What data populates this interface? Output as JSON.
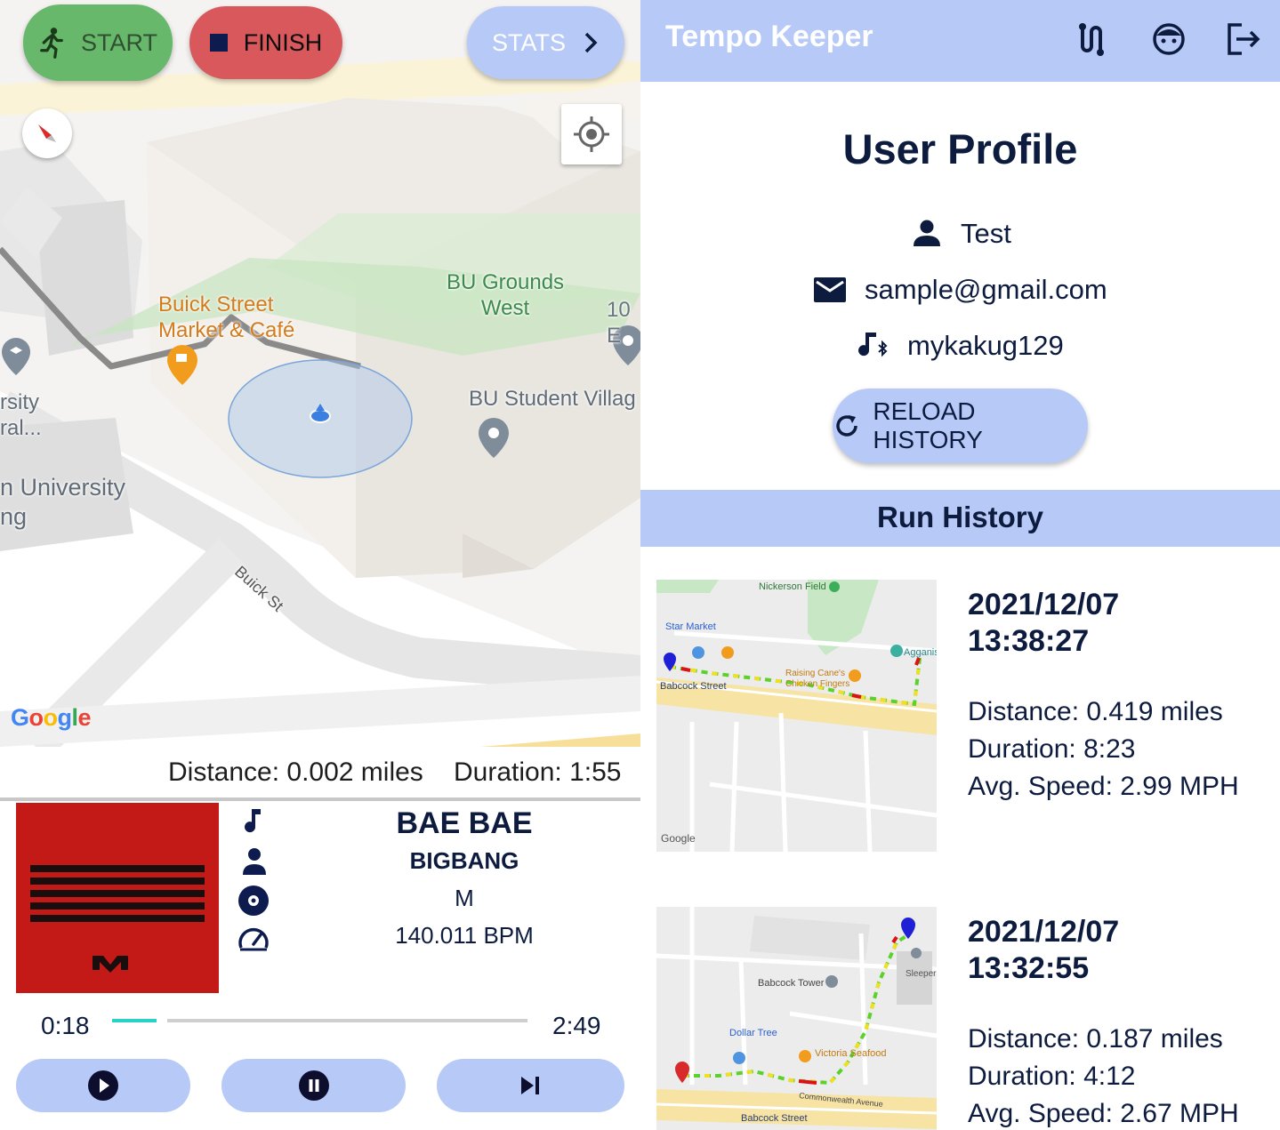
{
  "left": {
    "buttons": {
      "start": "START",
      "finish": "FINISH",
      "stats": "STATS"
    },
    "map": {
      "labels": {
        "buick_market": "Buick Street\nMarket & Café",
        "bu_grounds": "BU Grounds\nWest",
        "ten_b": "10 E",
        "student_village": "BU Student Villag",
        "rsity": "rsity\nral...",
        "university": "n University\nng",
        "buick_st": "Buick St"
      },
      "logo": "Google"
    },
    "session": {
      "distance": "Distance: 0.002 miles",
      "duration": "Duration: 1:55"
    },
    "track": {
      "title": "BAE BAE",
      "artist": "BIGBANG",
      "album": "M",
      "bpm": "140.011 BPM"
    },
    "player": {
      "elapsed": "0:18",
      "total": "2:49",
      "progress": 0.107
    }
  },
  "right": {
    "app_title": "Tempo Keeper",
    "profile_title": "User Profile",
    "user": {
      "name": "Test",
      "email": "sample@gmail.com",
      "music_account": "mykakug129"
    },
    "reload_label": "RELOAD HISTORY",
    "history_title": "Run History",
    "runs": [
      {
        "date": "2021/12/07",
        "time": "13:38:27",
        "distance": "Distance: 0.419 miles",
        "duration": "Duration: 8:23",
        "speed": "Avg. Speed: 2.99 MPH",
        "map_labels": {
          "a": "Nickerson Field",
          "b": "Star Market",
          "c": "Raising Cane's\nChicken Fingers",
          "d": "Babcock Street",
          "e": "Agganis",
          "f": "Google"
        }
      },
      {
        "date": "2021/12/07",
        "time": "13:32:55",
        "distance": "Distance: 0.187 miles",
        "duration": "Duration: 4:12",
        "speed": "Avg. Speed: 2.67 MPH",
        "map_labels": {
          "a": "Babcock Tower",
          "b": "Dollar Tree",
          "c": "Victoria Seafood",
          "d": "Babcock Street",
          "e": "Sleeper",
          "f": "Commonwealth Avenue"
        }
      }
    ]
  },
  "colors": {
    "accent": "#b7c9f7",
    "start": "#67b86b",
    "finish": "#d9585b",
    "navy": "#0d1b3e",
    "progress": "#2ad1c5"
  },
  "icons": [
    "runner-icon",
    "stop-icon",
    "chevron-right-icon",
    "route-icon",
    "face-icon",
    "logout-icon",
    "person-icon",
    "mail-icon",
    "music-bluetooth-icon",
    "refresh-icon",
    "music-note-icon",
    "disc-icon",
    "speedometer-icon",
    "play-icon",
    "pause-icon",
    "skip-next-icon",
    "compass-icon",
    "my-location-icon"
  ]
}
